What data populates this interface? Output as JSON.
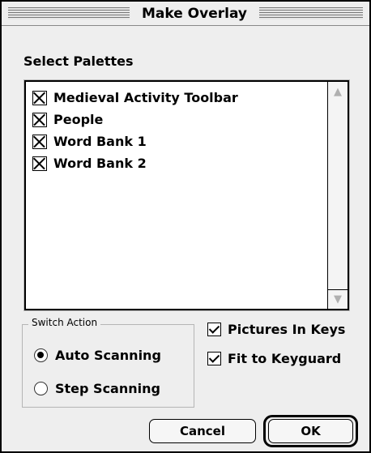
{
  "window": {
    "title": "Make Overlay"
  },
  "palettes": {
    "label": "Select Palettes",
    "items": [
      {
        "label": "Medieval Activity Toolbar",
        "checked": true
      },
      {
        "label": "People",
        "checked": true
      },
      {
        "label": "Word Bank 1",
        "checked": true
      },
      {
        "label": "Word Bank 2",
        "checked": true
      }
    ],
    "scroll_up_icon": "up-arrow",
    "scroll_down_icon": "down-arrow"
  },
  "switch_action": {
    "legend": "Switch Action",
    "options": [
      {
        "label": "Auto Scanning",
        "selected": true
      },
      {
        "label": "Step Scanning",
        "selected": false
      }
    ]
  },
  "options": {
    "pictures_in_keys": {
      "label": "Pictures In Keys",
      "checked": true
    },
    "fit_to_keyguard": {
      "label": "Fit to Keyguard",
      "checked": true
    }
  },
  "buttons": {
    "cancel": "Cancel",
    "ok": "OK"
  }
}
